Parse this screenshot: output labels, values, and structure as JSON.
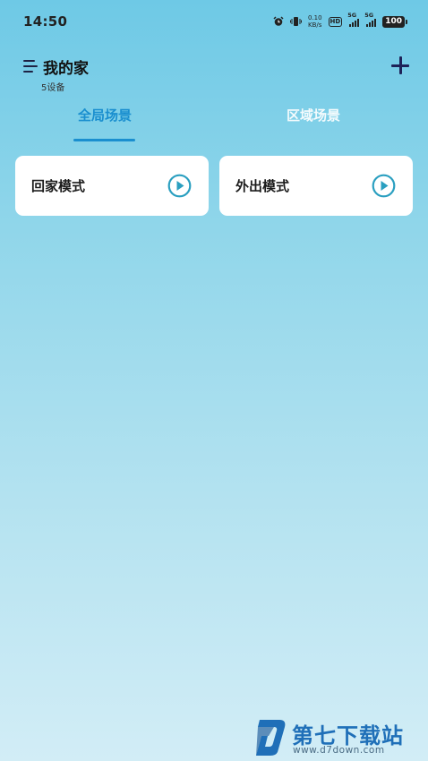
{
  "status_bar": {
    "time": "14:50",
    "net_speed_value": "0.10",
    "net_speed_unit": "KB/s",
    "hd_label": "HD",
    "sim1_label": "5G",
    "sim2_label": "5G",
    "battery": "100",
    "icons": [
      "alarm-icon",
      "vibrate-icon",
      "hd-voice-icon",
      "signal-icon",
      "battery-icon"
    ]
  },
  "header": {
    "title": "我的家",
    "device_count": "5设备",
    "menu_icon": "menu-icon",
    "add_icon": "plus-icon"
  },
  "tabs": [
    {
      "label": "全局场景",
      "active": true
    },
    {
      "label": "区域场景",
      "active": false
    }
  ],
  "scenes": [
    {
      "label": "回家模式",
      "icon": "play-icon"
    },
    {
      "label": "外出模式",
      "icon": "play-icon"
    }
  ],
  "watermark": {
    "title": "第七下载站",
    "url": "www.d7down.com"
  },
  "colors": {
    "accent": "#1a8fcf",
    "play_icon": "#2a9fc0",
    "background_top": "#6ec9e6",
    "background_bottom": "#d2edf6",
    "card": "#ffffff"
  }
}
